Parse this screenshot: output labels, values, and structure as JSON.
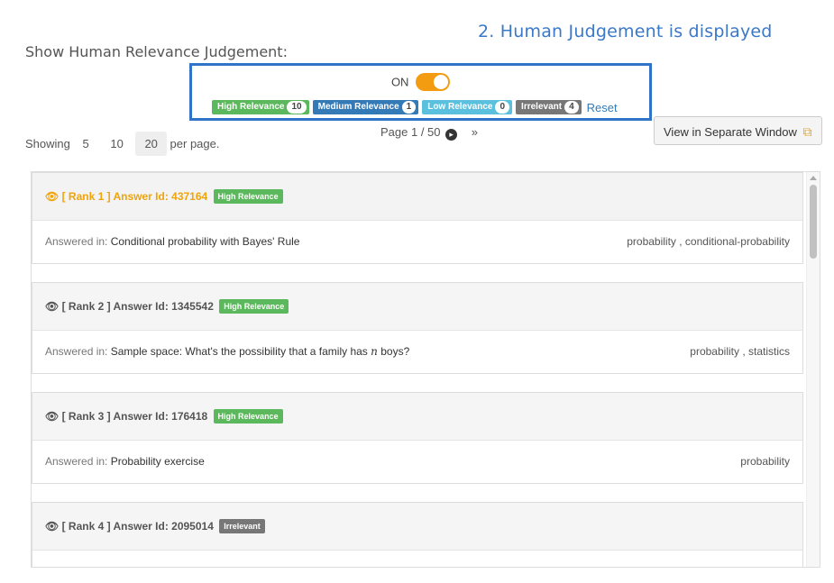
{
  "annotation": "2. Human Judgement is displayed",
  "relevance_filter": {
    "label": "Show Human Relevance Judgement:",
    "toggle_label": "ON",
    "toggle_state": true,
    "badges": [
      {
        "label": "High Relevance",
        "count": "10",
        "color": "#5cb85c"
      },
      {
        "label": "Medium Relevance",
        "count": "1",
        "color": "#337ab7"
      },
      {
        "label": "Low Relevance",
        "count": "0",
        "color": "#5bc0de"
      },
      {
        "label": "Irrelevant",
        "count": "4",
        "color": "#777777"
      }
    ],
    "reset_label": "Reset"
  },
  "pagination": {
    "showing_label": "Showing",
    "options": [
      "5",
      "10",
      "20"
    ],
    "selected": "20",
    "per_page_label": "per page.",
    "page_info": "Page 1 / 50",
    "next_icon": "chevron-circle-right-icon",
    "last_icon": "double-chevron-right-icon",
    "last_glyph": "»"
  },
  "separate_window_button": {
    "label": "View in Separate Window",
    "icon": "external-window-icon"
  },
  "answered_in_label": "Answered in:",
  "answers": [
    {
      "rank_text": "[ Rank 1 ]",
      "id_text": "Answer Id: 437164",
      "relevance": "High Relevance",
      "relevance_color": "#5cb85c",
      "question": "Conditional probability with Bayes' Rule",
      "tags": "probability , conditional-probability"
    },
    {
      "rank_text": "[ Rank 2 ]",
      "id_text": "Answer Id: 1345542",
      "relevance": "High Relevance",
      "relevance_color": "#5cb85c",
      "question_prefix": "Sample space: What's the possibility that a family has",
      "question_math": "n",
      "question_suffix": "boys?",
      "tags": "probability , statistics"
    },
    {
      "rank_text": "[ Rank 3 ]",
      "id_text": "Answer Id: 176418",
      "relevance": "High Relevance",
      "relevance_color": "#5cb85c",
      "question": "Probability exercise",
      "tags": "probability"
    },
    {
      "rank_text": "[ Rank 4 ]",
      "id_text": "Answer Id: 2095014",
      "relevance": "Irrelevant",
      "relevance_color": "#777777"
    }
  ]
}
